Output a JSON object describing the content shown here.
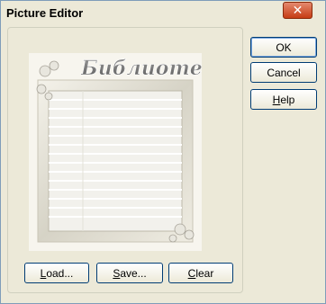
{
  "window": {
    "title": "Picture Editor",
    "close_icon": "close-icon"
  },
  "image": {
    "heading_text": "Библиотека",
    "description": ""
  },
  "buttons": {
    "ok": "OK",
    "cancel": "Cancel",
    "help_prefix": "H",
    "help_rest": "elp",
    "load_prefix": "L",
    "load_rest": "oad...",
    "save_prefix": "S",
    "save_rest": "ave...",
    "clear_prefix": "C",
    "clear_rest": "lear"
  }
}
